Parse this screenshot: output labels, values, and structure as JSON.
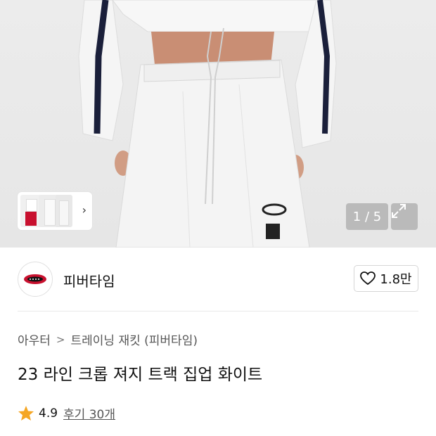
{
  "gallery": {
    "counter": "1 / 5",
    "thumbnail_chevron": "chevron-right-icon",
    "expand_icon": "expand-icon"
  },
  "brand": {
    "name": "피버타임",
    "logo_icon": "brand-logo-icon",
    "like_icon": "heart-icon",
    "like_count": "1.8만"
  },
  "breadcrumb": {
    "category": "아우터",
    "separator_icon": "chevron-right-icon",
    "subcategory": "트레이닝 재킷 (피버타임)"
  },
  "product": {
    "title": "23 라인 크롭 져지 트랙 집업 화이트"
  },
  "rating": {
    "star_icon": "star-icon",
    "value": "4.9",
    "reviews_label": "후기 30개",
    "star_color": "#f5a623"
  }
}
